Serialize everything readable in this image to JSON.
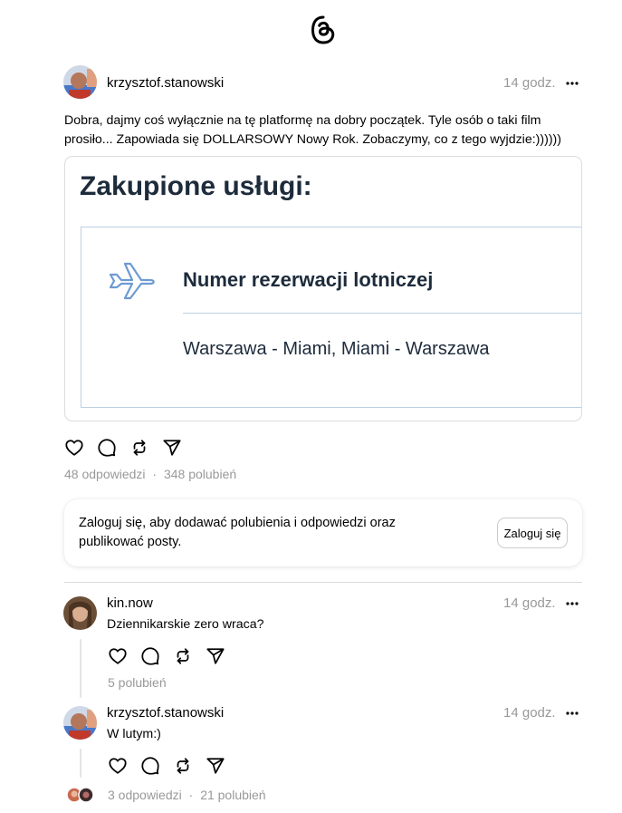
{
  "app": {
    "logo_icon": "threads-logo-icon"
  },
  "post": {
    "username": "krzysztof.stanowski",
    "time": "14 godz.",
    "text": "Dobra, dajmy coś wyłącznie na tę platformę na dobry początek. Tyle osób o taki film prosiło... Zapowiada się DOLLARSOWY Nowy Rok. Zobaczymy, co z tego wyjdzie:))))))",
    "media": {
      "title": "Zakupione usługi:",
      "heading": "Numer rezerwacji lotniczej",
      "route": "Warszawa - Miami, Miami - Warszawa",
      "icon": "airplane-icon"
    },
    "replies": "48 odpowiedzi",
    "separator": "·",
    "likes": "348 polubień"
  },
  "login_card": {
    "text": "Zaloguj się, aby dodawać polubienia i odpowiedzi oraz publikować posty.",
    "button": "Zaloguj się"
  },
  "comments": [
    {
      "username": "kin.now",
      "time": "14 godz.",
      "text": "Dziennikarskie zero wraca?",
      "likes": "5 polubień"
    },
    {
      "username": "krzysztof.stanowski",
      "time": "14 godz.",
      "text": "W lutym:)",
      "replies": "3 odpowiedzi",
      "separator": "·",
      "likes": "21 polubień"
    }
  ],
  "action_icons": [
    "heart-icon",
    "comment-icon",
    "repost-icon",
    "share-icon"
  ],
  "colors": {
    "muted": "#999999",
    "media_text": "#1d2b3b",
    "media_border": "#bcd0e2",
    "plane": "#6e9bd1"
  }
}
